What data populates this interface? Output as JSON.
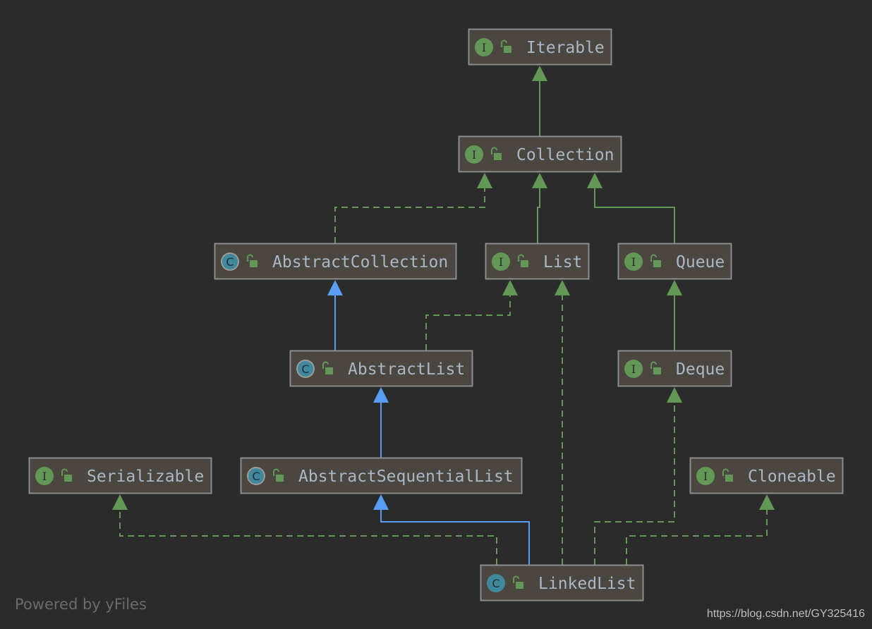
{
  "colors": {
    "background": "#2b2b2b",
    "node_fill": "#4b4740",
    "node_border": "#8c8c8c",
    "text": "#a9b7c6",
    "interface": "#629755",
    "class": "#40889c",
    "realization": "#629755",
    "extends_class": "#589df6"
  },
  "nodes": [
    {
      "id": "Iterable",
      "label": "Iterable",
      "kind": "interface",
      "icon": "interface-icon"
    },
    {
      "id": "Collection",
      "label": "Collection",
      "kind": "interface",
      "icon": "interface-icon"
    },
    {
      "id": "AbstractCollection",
      "label": "AbstractCollection",
      "kind": "abstract-class",
      "icon": "abstract-class-icon"
    },
    {
      "id": "List",
      "label": "List",
      "kind": "interface",
      "icon": "interface-icon"
    },
    {
      "id": "Queue",
      "label": "Queue",
      "kind": "interface",
      "icon": "interface-icon"
    },
    {
      "id": "AbstractList",
      "label": "AbstractList",
      "kind": "abstract-class",
      "icon": "abstract-class-icon"
    },
    {
      "id": "Deque",
      "label": "Deque",
      "kind": "interface",
      "icon": "interface-icon"
    },
    {
      "id": "Serializable",
      "label": "Serializable",
      "kind": "interface",
      "icon": "interface-icon"
    },
    {
      "id": "AbstractSequentialList",
      "label": "AbstractSequentialList",
      "kind": "abstract-class",
      "icon": "abstract-class-icon"
    },
    {
      "id": "Cloneable",
      "label": "Cloneable",
      "kind": "interface",
      "icon": "interface-icon"
    },
    {
      "id": "LinkedList",
      "label": "LinkedList",
      "kind": "class",
      "icon": "class-icon"
    }
  ],
  "edges": [
    {
      "from": "Collection",
      "to": "Iterable",
      "type": "extends-interface"
    },
    {
      "from": "AbstractCollection",
      "to": "Collection",
      "type": "implements"
    },
    {
      "from": "List",
      "to": "Collection",
      "type": "extends-interface"
    },
    {
      "from": "Queue",
      "to": "Collection",
      "type": "extends-interface"
    },
    {
      "from": "AbstractList",
      "to": "AbstractCollection",
      "type": "extends-class"
    },
    {
      "from": "AbstractList",
      "to": "List",
      "type": "implements"
    },
    {
      "from": "Deque",
      "to": "Queue",
      "type": "extends-interface"
    },
    {
      "from": "AbstractSequentialList",
      "to": "AbstractList",
      "type": "extends-class"
    },
    {
      "from": "LinkedList",
      "to": "List",
      "type": "implements"
    },
    {
      "from": "LinkedList",
      "to": "AbstractSequentialList",
      "type": "extends-class"
    },
    {
      "from": "LinkedList",
      "to": "Serializable",
      "type": "implements"
    },
    {
      "from": "LinkedList",
      "to": "Deque",
      "type": "implements"
    },
    {
      "from": "LinkedList",
      "to": "Cloneable",
      "type": "implements"
    }
  ],
  "footer": "Powered by yFiles",
  "watermark": "https://blog.csdn.net/GY325416"
}
